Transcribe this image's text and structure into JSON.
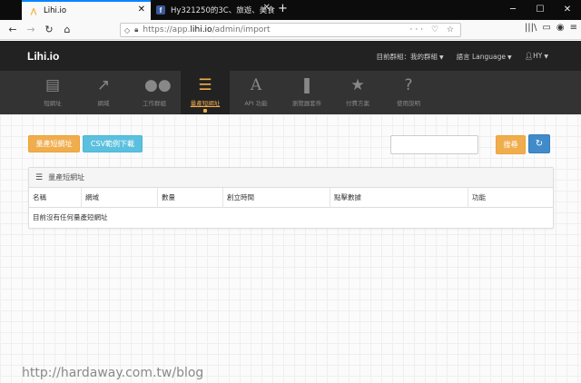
{
  "browser": {
    "tabs": [
      {
        "title": "Lihi.io",
        "favicon": "lihi-logo-icon",
        "active": true
      },
      {
        "title": "Hy321250的3C、旅遊、美食",
        "favicon": "facebook-icon",
        "active": false
      }
    ],
    "url_proto": "https://app.",
    "url_host": "lihi.io",
    "url_path": "/admin/import"
  },
  "app": {
    "brand": "Lihi.io",
    "header_links": {
      "current_group": "目前群組：我的群組",
      "language": "語言 Language",
      "user": "HY"
    },
    "modules": [
      {
        "label": "短網址",
        "icon": "list-alt-icon",
        "active": false
      },
      {
        "label": "網域",
        "icon": "external-link-icon",
        "active": false
      },
      {
        "label": "工作群組",
        "icon": "users-icon",
        "active": false
      },
      {
        "label": "量產短網址",
        "icon": "th-list-icon",
        "active": true
      },
      {
        "label": "API 功能",
        "icon": "api-font-icon",
        "active": false
      },
      {
        "label": "瀏覽器套件",
        "icon": "bookmark-icon",
        "active": false
      },
      {
        "label": "付費方案",
        "icon": "star-icon",
        "active": false
      },
      {
        "label": "使用說明",
        "icon": "question-circle-icon",
        "active": false
      }
    ]
  },
  "toolbar": {
    "bulk_button": "量產短網址",
    "csv_button": "CSV範例下載",
    "search_value": "",
    "search_button": "搜尋"
  },
  "panel": {
    "title": "量產短網址",
    "columns": [
      "名稱",
      "網域",
      "數量",
      "創立時間",
      "點擊數據",
      "功能"
    ],
    "empty_message": "目前沒有任何量產短網址"
  },
  "watermark": "http://hardaway.com.tw/blog",
  "colors": {
    "accent_orange": "#f0ad4e",
    "accent_cyan": "#5bc0de",
    "accent_blue": "#428bca",
    "header_dark": "#222222"
  }
}
